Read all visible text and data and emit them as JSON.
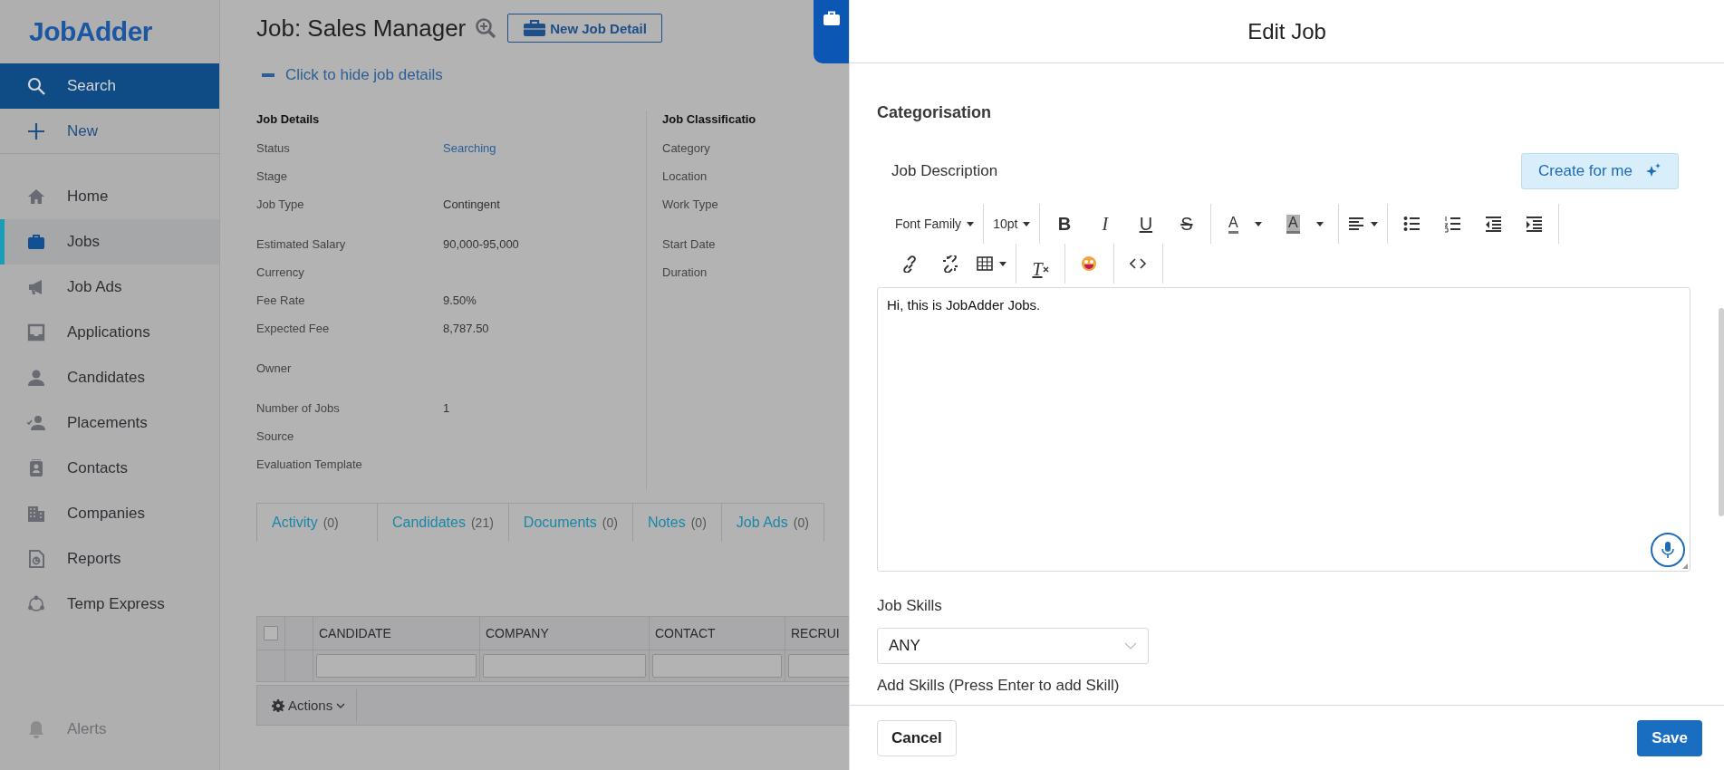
{
  "sidebar": {
    "logo": "JobAdder",
    "actions": [
      {
        "label": "Search",
        "kind": "search"
      },
      {
        "label": "New",
        "kind": "new"
      }
    ],
    "items": [
      {
        "label": "Home",
        "selected": false
      },
      {
        "label": "Jobs",
        "selected": true
      },
      {
        "label": "Job Ads",
        "selected": false
      },
      {
        "label": "Applications",
        "selected": false
      },
      {
        "label": "Candidates",
        "selected": false
      },
      {
        "label": "Placements",
        "selected": false
      },
      {
        "label": "Contacts",
        "selected": false
      },
      {
        "label": "Companies",
        "selected": false
      },
      {
        "label": "Reports",
        "selected": false
      },
      {
        "label": "Temp Express",
        "selected": false
      }
    ],
    "footer_items": [
      {
        "label": "Alerts"
      }
    ]
  },
  "job": {
    "title": "Job: Sales Manager",
    "new_detail_button": "New Job Detail",
    "toggle_link": "Click to hide job details",
    "columns": [
      {
        "heading": "Job Details",
        "groups": [
          {
            "rows": [
              {
                "label": "Status",
                "value": "Searching",
                "kind": "link"
              },
              {
                "label": "Stage"
              },
              {
                "label": "Job Type",
                "value": "Contingent",
                "kind": "text"
              }
            ]
          },
          {
            "rows": [
              {
                "label": "Estimated Salary",
                "value": "90,000-95,000",
                "kind": "text"
              },
              {
                "label": "Currency"
              },
              {
                "label": "Fee Rate",
                "value": "9.50%",
                "kind": "text"
              },
              {
                "label": "Expected Fee",
                "value": "8,787.50",
                "kind": "text"
              }
            ]
          },
          {
            "rows": [
              {
                "label": "Owner"
              }
            ]
          },
          {
            "rows": [
              {
                "label": "Number of Jobs",
                "value": "1",
                "kind": "text"
              },
              {
                "label": "Source"
              },
              {
                "label": "Evaluation Template"
              }
            ]
          }
        ]
      },
      {
        "heading": "Job Classificatio",
        "groups": [
          {
            "rows": [
              {
                "label": "Category"
              },
              {
                "label": "Location"
              },
              {
                "label": "Work Type"
              }
            ]
          },
          {
            "rows": [
              {
                "label": "Start Date"
              },
              {
                "label": "Duration"
              }
            ]
          }
        ]
      }
    ],
    "tabs": [
      {
        "label": "Activity",
        "count": "(0)"
      },
      {
        "label": "Candidates",
        "count": "(21)"
      },
      {
        "label": "Documents",
        "count": "(0)"
      },
      {
        "label": "Notes",
        "count": "(0)"
      },
      {
        "label": "Job Ads",
        "count": "(0)"
      }
    ],
    "table": {
      "select_all": {
        "checked": false
      },
      "columns": [
        "CANDIDATE",
        "COMPANY",
        "CONTACT",
        "RECRUI"
      ]
    },
    "actions_button": "Actions"
  },
  "edit_panel": {
    "title": "Edit Job",
    "section": "Categorisation",
    "description_label": "Job Description",
    "create_button": "Create for me",
    "toolbar": [
      [
        [
          {
            "kind": "dropdown",
            "label": "Font Family"
          }
        ],
        [
          {
            "kind": "dropdown",
            "label": "10pt"
          }
        ],
        [
          {
            "kind": "bold",
            "label": "B"
          },
          {
            "kind": "italic",
            "label": "I"
          },
          {
            "kind": "underline",
            "label": "U"
          },
          {
            "kind": "strike",
            "label": "S"
          }
        ],
        [
          {
            "kind": "text-color",
            "label": "A"
          },
          {
            "kind": "highlight",
            "label": "A"
          }
        ],
        [
          {
            "kind": "align"
          }
        ],
        [
          {
            "kind": "bullets"
          },
          {
            "kind": "numbers"
          },
          {
            "kind": "outdent"
          },
          {
            "kind": "indent"
          }
        ]
      ],
      [
        [
          {
            "kind": "link"
          },
          {
            "kind": "unlink"
          },
          {
            "kind": "table"
          }
        ],
        [
          {
            "kind": "clear-format",
            "label": "T"
          }
        ],
        [
          {
            "kind": "emoji"
          }
        ],
        [
          {
            "kind": "code"
          }
        ]
      ]
    ],
    "description": "Hi, this is JobAdder Jobs.",
    "skills_label": "Job Skills",
    "skills_select": "ANY",
    "add_skills_label": "Add Skills (Press Enter to add Skill)",
    "cancel_button": "Cancel",
    "save_button": "Save"
  }
}
